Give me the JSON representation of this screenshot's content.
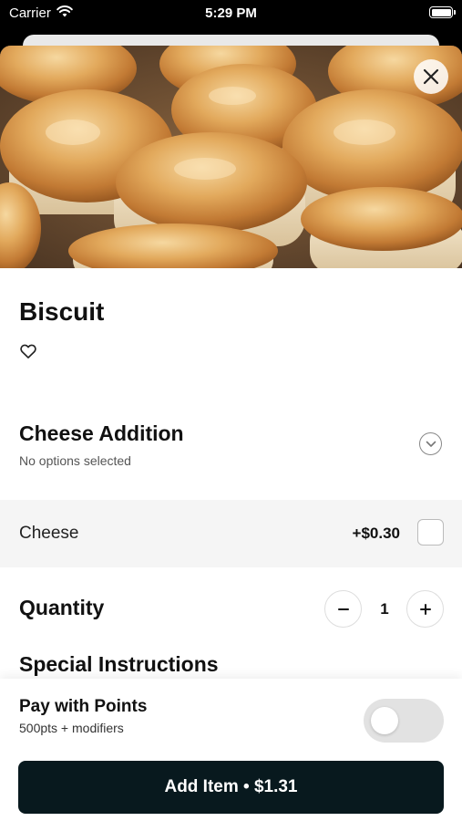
{
  "status_bar": {
    "carrier": "Carrier",
    "time": "5:29 PM",
    "wifi_icon": "wifi-icon",
    "battery_icon": "battery-icon",
    "battery_level": 1.0
  },
  "item": {
    "title": "Biscuit",
    "image_alt": "biscuits",
    "favorite_icon": "heart-outline-icon",
    "close_icon": "close-icon"
  },
  "modifier_group": {
    "title": "Cheese Addition",
    "subtitle": "No options selected",
    "expand_icon": "chevron-down-icon",
    "options": [
      {
        "name": "Cheese",
        "price": "+$0.30",
        "checked": false
      }
    ]
  },
  "quantity": {
    "label": "Quantity",
    "value": "1",
    "decrement_icon": "minus-icon",
    "increment_icon": "plus-icon"
  },
  "special_instructions": {
    "label": "Special Instructions"
  },
  "points": {
    "title": "Pay with Points",
    "subtitle": "500pts + modifiers",
    "enabled": false
  },
  "cta": {
    "label": "Add Item • $1.31"
  },
  "colors": {
    "cta_background": "#08191e",
    "toggle_off": "#e2e2e2",
    "option_row_background": "#f5f5f5"
  }
}
